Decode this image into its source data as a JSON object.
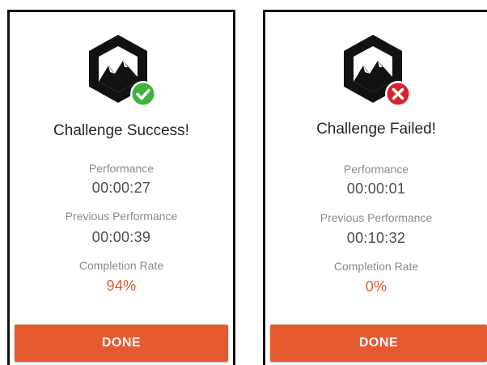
{
  "colors": {
    "accent": "#e55a2f",
    "rate_text": "#e55a2a",
    "success_badge": "#3db33d",
    "failure_badge": "#d8232f",
    "logo_dark": "#111111"
  },
  "cards": [
    {
      "status": "success",
      "badge_icon": "checkmark-icon",
      "title": "Challenge Success!",
      "performance_label": "Performance",
      "performance_value": "00:00:27",
      "previous_label": "Previous Performance",
      "previous_value": "00:00:39",
      "rate_label": "Completion Rate",
      "rate_value": "94%",
      "done_label": "DONE"
    },
    {
      "status": "failed",
      "badge_icon": "x-mark-icon",
      "title": "Challenge Failed!",
      "performance_label": "Performance",
      "performance_value": "00:00:01",
      "previous_label": "Previous Performance",
      "previous_value": "00:10:32",
      "rate_label": "Completion Rate",
      "rate_value": "0%",
      "done_label": "DONE"
    }
  ]
}
